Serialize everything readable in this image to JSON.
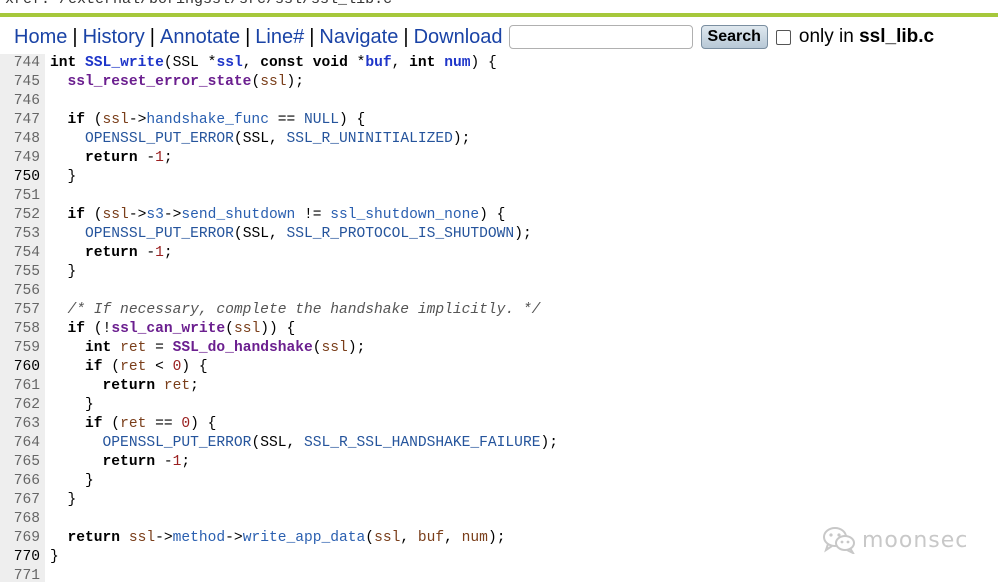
{
  "path_bar": {
    "prefix": "xref: ",
    "path": "/external/boringssl/src/ssl/ssl_lib.c"
  },
  "nav": {
    "links": [
      "Home",
      "History",
      "Annotate",
      "Line#",
      "Navigate",
      "Download"
    ],
    "separator": "|",
    "search_button": "Search",
    "only_in_prefix": "only in ",
    "only_in_file": "ssl_lib.c"
  },
  "colors": {
    "accent_rule": "#a6c83b",
    "nav_link": "#1a43a6",
    "function_name": "#6b1f8f",
    "macro": "#25549c",
    "number": "#9a2020"
  },
  "code": {
    "lines": [
      {
        "n": "744",
        "hl": false,
        "t": [
          [
            "kw",
            "int"
          ],
          [
            "p",
            " "
          ],
          [
            "fname",
            "SSL_write"
          ],
          [
            "p",
            "("
          ],
          [
            "pl",
            "SSL"
          ],
          [
            "p",
            " *"
          ],
          [
            "fname",
            "ssl"
          ],
          [
            "p",
            ", "
          ],
          [
            "kw",
            "const"
          ],
          [
            "p",
            " "
          ],
          [
            "kw",
            "void"
          ],
          [
            "p",
            " *"
          ],
          [
            "fname",
            "buf"
          ],
          [
            "p",
            ", "
          ],
          [
            "kw",
            "int"
          ],
          [
            "p",
            " "
          ],
          [
            "fname",
            "num"
          ],
          [
            "p",
            ") {"
          ]
        ]
      },
      {
        "n": "745",
        "hl": false,
        "t": [
          [
            "p",
            "  "
          ],
          [
            "fn",
            "ssl_reset_error_state"
          ],
          [
            "p",
            "("
          ],
          [
            "var",
            "ssl"
          ],
          [
            "p",
            ");"
          ]
        ]
      },
      {
        "n": "746",
        "hl": false,
        "t": []
      },
      {
        "n": "747",
        "hl": false,
        "t": [
          [
            "p",
            "  "
          ],
          [
            "kw",
            "if"
          ],
          [
            "p",
            " ("
          ],
          [
            "var",
            "ssl"
          ],
          [
            "p",
            "->"
          ],
          [
            "mem",
            "handshake_func"
          ],
          [
            "p",
            " == "
          ],
          [
            "macro",
            "NULL"
          ],
          [
            "p",
            ") {"
          ]
        ]
      },
      {
        "n": "748",
        "hl": false,
        "t": [
          [
            "p",
            "    "
          ],
          [
            "macro",
            "OPENSSL_PUT_ERROR"
          ],
          [
            "p",
            "("
          ],
          [
            "pl",
            "SSL"
          ],
          [
            "p",
            ", "
          ],
          [
            "macro",
            "SSL_R_UNINITIALIZED"
          ],
          [
            "p",
            ");"
          ]
        ]
      },
      {
        "n": "749",
        "hl": false,
        "t": [
          [
            "p",
            "    "
          ],
          [
            "kw",
            "return"
          ],
          [
            "p",
            " -"
          ],
          [
            "num",
            "1"
          ],
          [
            "p",
            ";"
          ]
        ]
      },
      {
        "n": "750",
        "hl": true,
        "t": [
          [
            "p",
            "  }"
          ]
        ]
      },
      {
        "n": "751",
        "hl": false,
        "t": []
      },
      {
        "n": "752",
        "hl": false,
        "t": [
          [
            "p",
            "  "
          ],
          [
            "kw",
            "if"
          ],
          [
            "p",
            " ("
          ],
          [
            "var",
            "ssl"
          ],
          [
            "p",
            "->"
          ],
          [
            "mem",
            "s3"
          ],
          [
            "p",
            "->"
          ],
          [
            "mem",
            "send_shutdown"
          ],
          [
            "p",
            " != "
          ],
          [
            "mem",
            "ssl_shutdown_none"
          ],
          [
            "p",
            ") {"
          ]
        ]
      },
      {
        "n": "753",
        "hl": false,
        "t": [
          [
            "p",
            "    "
          ],
          [
            "macro",
            "OPENSSL_PUT_ERROR"
          ],
          [
            "p",
            "("
          ],
          [
            "pl",
            "SSL"
          ],
          [
            "p",
            ", "
          ],
          [
            "macro",
            "SSL_R_PROTOCOL_IS_SHUTDOWN"
          ],
          [
            "p",
            ");"
          ]
        ]
      },
      {
        "n": "754",
        "hl": false,
        "t": [
          [
            "p",
            "    "
          ],
          [
            "kw",
            "return"
          ],
          [
            "p",
            " -"
          ],
          [
            "num",
            "1"
          ],
          [
            "p",
            ";"
          ]
        ]
      },
      {
        "n": "755",
        "hl": false,
        "t": [
          [
            "p",
            "  }"
          ]
        ]
      },
      {
        "n": "756",
        "hl": false,
        "t": []
      },
      {
        "n": "757",
        "hl": false,
        "t": [
          [
            "p",
            "  "
          ],
          [
            "cm",
            "/* If necessary, complete the handshake implicitly. */"
          ]
        ]
      },
      {
        "n": "758",
        "hl": false,
        "t": [
          [
            "p",
            "  "
          ],
          [
            "kw",
            "if"
          ],
          [
            "p",
            " (!"
          ],
          [
            "fn",
            "ssl_can_write"
          ],
          [
            "p",
            "("
          ],
          [
            "var",
            "ssl"
          ],
          [
            "p",
            ")) {"
          ]
        ]
      },
      {
        "n": "759",
        "hl": false,
        "t": [
          [
            "p",
            "    "
          ],
          [
            "kw",
            "int"
          ],
          [
            "p",
            " "
          ],
          [
            "var",
            "ret"
          ],
          [
            "p",
            " = "
          ],
          [
            "fn",
            "SSL_do_handshake"
          ],
          [
            "p",
            "("
          ],
          [
            "var",
            "ssl"
          ],
          [
            "p",
            ");"
          ]
        ]
      },
      {
        "n": "760",
        "hl": true,
        "t": [
          [
            "p",
            "    "
          ],
          [
            "kw",
            "if"
          ],
          [
            "p",
            " ("
          ],
          [
            "var",
            "ret"
          ],
          [
            "p",
            " < "
          ],
          [
            "num",
            "0"
          ],
          [
            "p",
            ") {"
          ]
        ]
      },
      {
        "n": "761",
        "hl": false,
        "t": [
          [
            "p",
            "      "
          ],
          [
            "kw",
            "return"
          ],
          [
            "p",
            " "
          ],
          [
            "var",
            "ret"
          ],
          [
            "p",
            ";"
          ]
        ]
      },
      {
        "n": "762",
        "hl": false,
        "t": [
          [
            "p",
            "    }"
          ]
        ]
      },
      {
        "n": "763",
        "hl": false,
        "t": [
          [
            "p",
            "    "
          ],
          [
            "kw",
            "if"
          ],
          [
            "p",
            " ("
          ],
          [
            "var",
            "ret"
          ],
          [
            "p",
            " == "
          ],
          [
            "num",
            "0"
          ],
          [
            "p",
            ") {"
          ]
        ]
      },
      {
        "n": "764",
        "hl": false,
        "t": [
          [
            "p",
            "      "
          ],
          [
            "macro",
            "OPENSSL_PUT_ERROR"
          ],
          [
            "p",
            "("
          ],
          [
            "pl",
            "SSL"
          ],
          [
            "p",
            ", "
          ],
          [
            "macro",
            "SSL_R_SSL_HANDSHAKE_FAILURE"
          ],
          [
            "p",
            ");"
          ]
        ]
      },
      {
        "n": "765",
        "hl": false,
        "t": [
          [
            "p",
            "      "
          ],
          [
            "kw",
            "return"
          ],
          [
            "p",
            " -"
          ],
          [
            "num",
            "1"
          ],
          [
            "p",
            ";"
          ]
        ]
      },
      {
        "n": "766",
        "hl": false,
        "t": [
          [
            "p",
            "    }"
          ]
        ]
      },
      {
        "n": "767",
        "hl": false,
        "t": [
          [
            "p",
            "  }"
          ]
        ]
      },
      {
        "n": "768",
        "hl": false,
        "t": []
      },
      {
        "n": "769",
        "hl": false,
        "t": [
          [
            "p",
            "  "
          ],
          [
            "kw",
            "return"
          ],
          [
            "p",
            " "
          ],
          [
            "var",
            "ssl"
          ],
          [
            "p",
            "->"
          ],
          [
            "mem",
            "method"
          ],
          [
            "p",
            "->"
          ],
          [
            "mem",
            "write_app_data"
          ],
          [
            "p",
            "("
          ],
          [
            "var",
            "ssl"
          ],
          [
            "p",
            ", "
          ],
          [
            "var",
            "buf"
          ],
          [
            "p",
            ", "
          ],
          [
            "var",
            "num"
          ],
          [
            "p",
            ");"
          ]
        ]
      },
      {
        "n": "770",
        "hl": true,
        "t": [
          [
            "p",
            "}"
          ]
        ]
      },
      {
        "n": "771",
        "hl": false,
        "t": []
      }
    ]
  },
  "watermark": {
    "text": "moonsec",
    "icon": "wechat-icon"
  }
}
